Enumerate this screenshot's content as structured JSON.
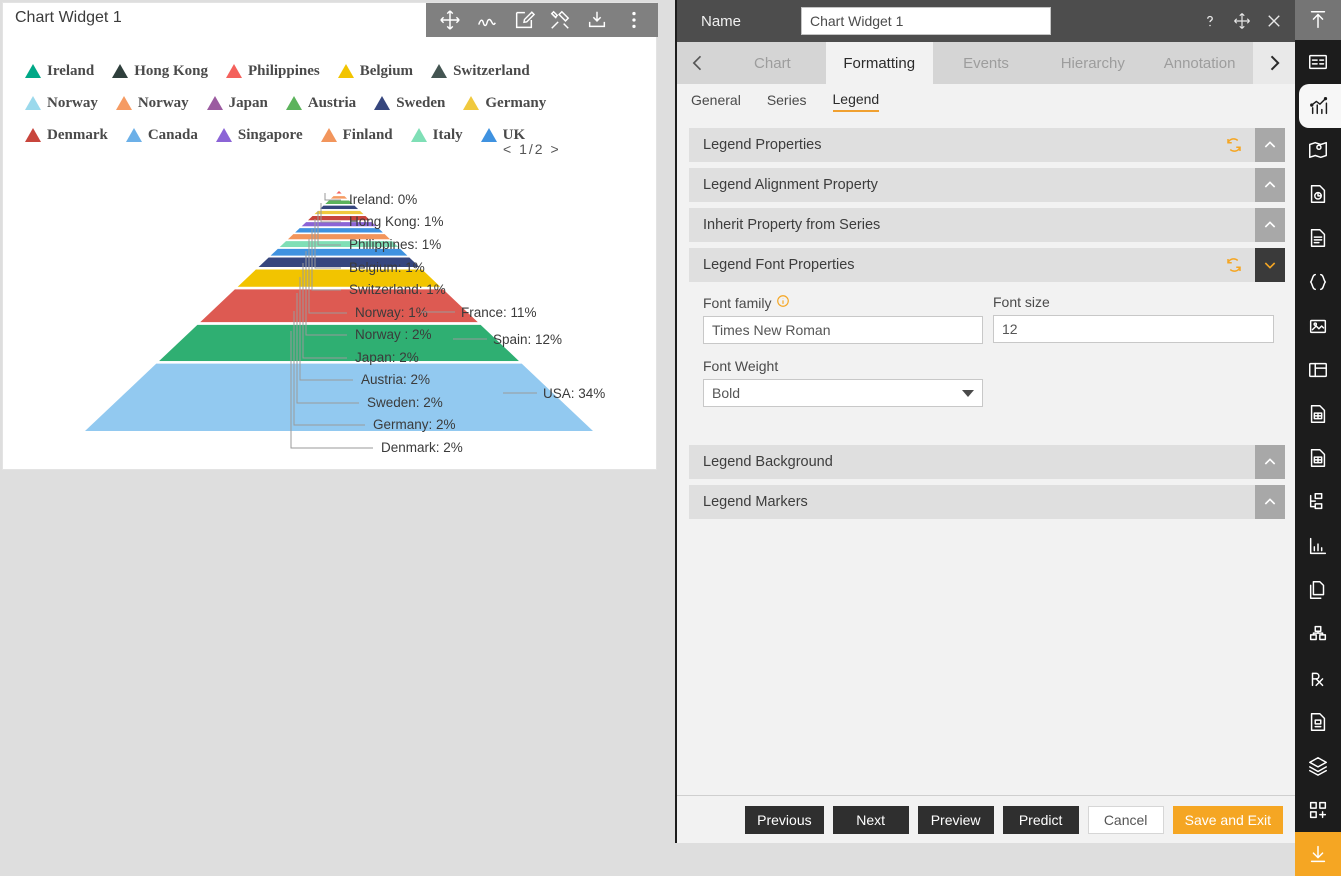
{
  "widget": {
    "title": "Chart Widget 1",
    "toolbar": [
      {
        "name": "move-icon",
        "label": "Move"
      },
      {
        "name": "scribble-icon",
        "label": "Scribble"
      },
      {
        "name": "edit-icon",
        "label": "Edit"
      },
      {
        "name": "tools-icon",
        "label": "Tools"
      },
      {
        "name": "download-icon",
        "label": "Download"
      },
      {
        "name": "more-vertical-icon",
        "label": "More"
      }
    ]
  },
  "legend": {
    "pager": {
      "prev": "<",
      "current": "1/2",
      "next": ">"
    },
    "rows": [
      [
        {
          "label": "Ireland",
          "color": "#00a887"
        },
        {
          "label": "Hong Kong",
          "color": "#2f3f3c"
        },
        {
          "label": "Philippines",
          "color": "#f4615c"
        },
        {
          "label": "Belgium",
          "color": "#f2c400"
        },
        {
          "label": "Switzerland",
          "color": "#445552"
        }
      ],
      [
        {
          "label": "Norway",
          "color": "#9bd9ec"
        },
        {
          "label": "Norway",
          "color": "#f59b63"
        },
        {
          "label": "Japan",
          "color": "#9b5ba0"
        },
        {
          "label": "Austria",
          "color": "#5cb35c"
        },
        {
          "label": "Sweden",
          "color": "#36467e"
        },
        {
          "label": "Germany",
          "color": "#f0c93e"
        }
      ],
      [
        {
          "label": "Denmark",
          "color": "#c8453c"
        },
        {
          "label": "Canada",
          "color": "#6cb0e8"
        },
        {
          "label": "Singapore",
          "color": "#8b64d6"
        },
        {
          "label": "Finland",
          "color": "#f2955c"
        },
        {
          "label": "Italy",
          "color": "#7fdfb6"
        },
        {
          "label": "UK",
          "color": "#3f92e0"
        }
      ]
    ]
  },
  "chart_data": {
    "type": "pie",
    "title": "",
    "subtype": "pyramid",
    "xlabel": "",
    "ylabel": "",
    "legend_position": "top",
    "grid": false,
    "categories": [
      "Ireland",
      "Hong Kong",
      "Philippines",
      "Belgium",
      "Switzerland",
      "Norway",
      "Norway ",
      "Japan",
      "Austria",
      "Sweden",
      "Germany",
      "Denmark",
      "France",
      "Spain",
      "USA"
    ],
    "values": [
      0,
      1,
      1,
      1,
      1,
      1,
      2,
      2,
      2,
      2,
      2,
      2,
      11,
      12,
      34
    ],
    "unit": "%",
    "labels": [
      {
        "text": "Ireland: 0%",
        "value": 0,
        "color": "#f4615c"
      },
      {
        "text": "Hong Kong: 1%",
        "value": 1,
        "color": "#f59b63"
      },
      {
        "text": "Philippines: 1%",
        "value": 1,
        "color": "#5cb35c"
      },
      {
        "text": "Belgium: 1%",
        "value": 1,
        "color": "#3f92e0"
      },
      {
        "text": "Switzerland: 1%",
        "value": 1,
        "color": "#9b5ba0"
      },
      {
        "text": "Norway: 1%",
        "value": 1,
        "color": "#dd5a52"
      },
      {
        "text": "Norway : 2%",
        "value": 2,
        "color": "#2faf72"
      },
      {
        "text": "Japan: 2%",
        "value": 2,
        "color": "#6cb0e8"
      },
      {
        "text": "Austria: 2%",
        "value": 2,
        "color": "#7fdfb6"
      },
      {
        "text": "Sweden: 2%",
        "value": 2,
        "color": "#36467e"
      },
      {
        "text": "Germany: 2%",
        "value": 2,
        "color": "#f0c93e"
      },
      {
        "text": "Denmark: 2%",
        "value": 2,
        "color": "#c8453c"
      },
      {
        "text": "France: 11%",
        "value": 11,
        "color": "#dd5a52"
      },
      {
        "text": "Spain: 12%",
        "value": 12,
        "color": "#2faf72"
      },
      {
        "text": "USA: 34%",
        "value": 34,
        "color": "#92c9f0"
      }
    ]
  },
  "panel": {
    "name_label": "Name",
    "name_value": "Chart Widget 1",
    "name_placeholder": "Chart Widget 1",
    "head_icons": [
      {
        "name": "help-icon",
        "glyph": "?"
      },
      {
        "name": "move-icon",
        "glyph": "move"
      },
      {
        "name": "close-icon",
        "glyph": "close"
      }
    ],
    "tabs": [
      {
        "label": "Chart",
        "active": false
      },
      {
        "label": "Formatting",
        "active": true
      },
      {
        "label": "Events",
        "active": false
      },
      {
        "label": "Hierarchy",
        "active": false
      },
      {
        "label": "Annotation",
        "active": false
      }
    ],
    "subtabs": [
      {
        "label": "General",
        "active": false
      },
      {
        "label": "Series",
        "active": false
      },
      {
        "label": "Legend",
        "active": true
      }
    ],
    "sections": [
      {
        "title": "Legend Properties",
        "open": false,
        "has_reset": true
      },
      {
        "title": "Legend Alignment Property",
        "open": false,
        "has_reset": false
      },
      {
        "title": "Inherit Property from Series",
        "open": false,
        "has_reset": false
      },
      {
        "title": "Legend Font Properties",
        "open": true,
        "has_reset": true
      },
      {
        "title": "Legend Background",
        "open": false,
        "has_reset": false
      },
      {
        "title": "Legend Markers",
        "open": false,
        "has_reset": false
      }
    ],
    "font_form": {
      "font_family_label": "Font family",
      "font_family_value": "Times New Roman",
      "font_family_placeholder": "Times New Roman",
      "font_size_label": "Font size",
      "font_size_value": "12",
      "font_size_placeholder": "12",
      "font_weight_label": "Font Weight",
      "font_weight_value": "Bold"
    },
    "footer_buttons": [
      {
        "label": "Previous",
        "style": "dark"
      },
      {
        "label": "Next",
        "style": "dark"
      },
      {
        "label": "Preview",
        "style": "dark"
      },
      {
        "label": "Predict",
        "style": "dark"
      },
      {
        "label": "Cancel",
        "style": "light"
      },
      {
        "label": "Save and Exit",
        "style": "accent"
      }
    ]
  },
  "rail": [
    {
      "name": "upload-icon",
      "state": "top"
    },
    {
      "name": "dashboard-icon",
      "state": "normal"
    },
    {
      "name": "chart-icon",
      "state": "selected"
    },
    {
      "name": "map-icon",
      "state": "normal"
    },
    {
      "name": "report-pie-icon",
      "state": "normal"
    },
    {
      "name": "document-icon",
      "state": "normal"
    },
    {
      "name": "code-braces-icon",
      "state": "normal"
    },
    {
      "name": "image-icon",
      "state": "normal"
    },
    {
      "name": "layout-icon",
      "state": "normal"
    },
    {
      "name": "file-grid-icon",
      "state": "normal"
    },
    {
      "name": "spreadsheet-icon",
      "state": "normal"
    },
    {
      "name": "hierarchy-icon",
      "state": "normal"
    },
    {
      "name": "bar-chart-icon",
      "state": "normal"
    },
    {
      "name": "copy-file-icon",
      "state": "normal"
    },
    {
      "name": "cubes-icon",
      "state": "normal"
    },
    {
      "name": "prescription-icon",
      "state": "normal"
    },
    {
      "name": "file-list-icon",
      "state": "normal"
    },
    {
      "name": "layers-icon",
      "state": "normal"
    },
    {
      "name": "add-widget-icon",
      "state": "normal"
    },
    {
      "name": "download-icon",
      "state": "bottom"
    }
  ],
  "colors": {
    "accent": "#f5a623",
    "panel_bg": "#f2f2f2",
    "header_bg": "#4d4d4d",
    "rail_bg": "#1c1c1c"
  }
}
